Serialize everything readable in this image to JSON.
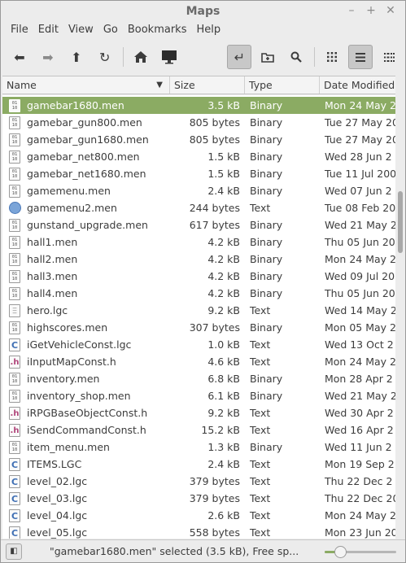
{
  "window": {
    "title": "Maps"
  },
  "menu": [
    "File",
    "Edit",
    "View",
    "Go",
    "Bookmarks",
    "Help"
  ],
  "toolbar": {
    "icons": [
      "back-icon",
      "forward-icon",
      "up-icon",
      "reload-icon",
      "home-icon",
      "computer-icon",
      "toggle-location-icon",
      "new-folder-icon",
      "search-icon",
      "icon-view-icon",
      "list-view-icon",
      "compact-view-icon"
    ]
  },
  "columns": {
    "name": "Name",
    "size": "Size",
    "type": "Type",
    "date": "Date Modified"
  },
  "files": [
    {
      "name": "gamebar1680.men",
      "size": "3.5 kB",
      "type": "Binary",
      "date": "Mon 24 May 2",
      "icon": "binary",
      "selected": true
    },
    {
      "name": "gamebar_gun800.men",
      "size": "805 bytes",
      "type": "Binary",
      "date": "Tue 27 May 20",
      "icon": "binary"
    },
    {
      "name": "gamebar_gun1680.men",
      "size": "805 bytes",
      "type": "Binary",
      "date": "Tue 27 May 20",
      "icon": "binary"
    },
    {
      "name": "gamebar_net800.men",
      "size": "1.5 kB",
      "type": "Binary",
      "date": "Wed 28 Jun 2",
      "icon": "binary"
    },
    {
      "name": "gamebar_net1680.men",
      "size": "1.5 kB",
      "type": "Binary",
      "date": "Tue 11 Jul 200",
      "icon": "binary"
    },
    {
      "name": "gamemenu.men",
      "size": "2.4 kB",
      "type": "Binary",
      "date": "Wed 07 Jun 2",
      "icon": "binary"
    },
    {
      "name": "gamemenu2.men",
      "size": "244 bytes",
      "type": "Text",
      "date": "Tue 08 Feb 20",
      "icon": "globe"
    },
    {
      "name": "gunstand_upgrade.men",
      "size": "617 bytes",
      "type": "Binary",
      "date": "Wed 21 May 2",
      "icon": "binary"
    },
    {
      "name": "hall1.men",
      "size": "4.2 kB",
      "type": "Binary",
      "date": "Thu 05 Jun 20",
      "icon": "binary"
    },
    {
      "name": "hall2.men",
      "size": "4.2 kB",
      "type": "Binary",
      "date": "Mon 24 May 2",
      "icon": "binary"
    },
    {
      "name": "hall3.men",
      "size": "4.2 kB",
      "type": "Binary",
      "date": "Wed 09 Jul 20",
      "icon": "binary"
    },
    {
      "name": "hall4.men",
      "size": "4.2 kB",
      "type": "Binary",
      "date": "Thu 05 Jun 20",
      "icon": "binary"
    },
    {
      "name": "hero.lgc",
      "size": "9.2 kB",
      "type": "Text",
      "date": "Wed 14 May 2",
      "icon": "txt"
    },
    {
      "name": "highscores.men",
      "size": "307 bytes",
      "type": "Binary",
      "date": "Mon 05 May 2",
      "icon": "binary"
    },
    {
      "name": "iGetVehicleConst.lgc",
      "size": "1.0 kB",
      "type": "Text",
      "date": "Wed 13 Oct 2",
      "icon": "c"
    },
    {
      "name": "iInputMapConst.h",
      "size": "4.6 kB",
      "type": "Text",
      "date": "Mon 24 May 2",
      "icon": "h"
    },
    {
      "name": "inventory.men",
      "size": "6.8 kB",
      "type": "Binary",
      "date": "Mon 28 Apr 2",
      "icon": "binary"
    },
    {
      "name": "inventory_shop.men",
      "size": "6.1 kB",
      "type": "Binary",
      "date": "Wed 21 May 2",
      "icon": "binary"
    },
    {
      "name": "iRPGBaseObjectConst.h",
      "size": "9.2 kB",
      "type": "Text",
      "date": "Wed 30 Apr 2",
      "icon": "h"
    },
    {
      "name": "iSendCommandConst.h",
      "size": "15.2 kB",
      "type": "Text",
      "date": "Wed 16 Apr 2",
      "icon": "h"
    },
    {
      "name": "item_menu.men",
      "size": "1.3 kB",
      "type": "Binary",
      "date": "Wed 11 Jun 2",
      "icon": "binary"
    },
    {
      "name": "ITEMS.LGC",
      "size": "2.4 kB",
      "type": "Text",
      "date": "Mon 19 Sep 2",
      "icon": "c"
    },
    {
      "name": "level_02.lgc",
      "size": "379 bytes",
      "type": "Text",
      "date": "Thu 22 Dec 2",
      "icon": "c"
    },
    {
      "name": "level_03.lgc",
      "size": "379 bytes",
      "type": "Text",
      "date": "Thu 22 Dec 20",
      "icon": "c"
    },
    {
      "name": "level_04.lgc",
      "size": "2.6 kB",
      "type": "Text",
      "date": "Mon 24 May 2",
      "icon": "c"
    },
    {
      "name": "level_05.lgc",
      "size": "558 bytes",
      "type": "Text",
      "date": "Mon 23 Jun 20",
      "icon": "c"
    }
  ],
  "status": {
    "text": "\"gamebar1680.men\" selected (3.5 kB), Free sp...",
    "zoom_fraction": 0.22
  }
}
